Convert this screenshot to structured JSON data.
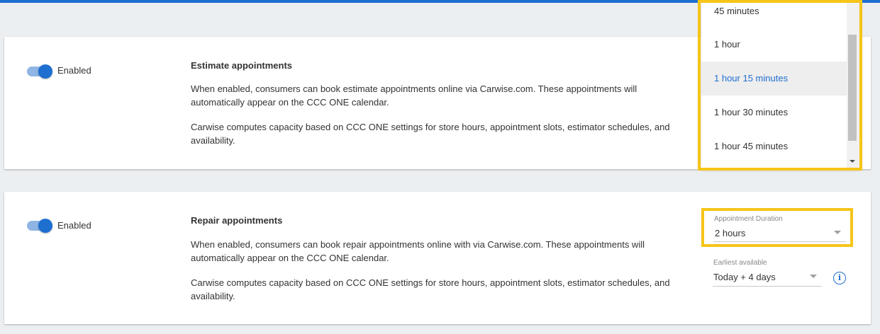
{
  "sections": [
    {
      "toggle_label": "Enabled",
      "title": "Estimate appointments",
      "para1": "When enabled, consumers can book estimate appointments online via Carwise.com. These appointments will automatically appear on the CCC ONE calendar.",
      "para2": "Carwise computes capacity based on CCC ONE settings for store hours, appointment slots, estimator schedules, and availability."
    },
    {
      "toggle_label": "Enabled",
      "title": "Repair appointments",
      "para1": "When enabled, consumers can book repair appointments online with via Carwise.com. These appointments will automatically appear on the CCC ONE calendar.",
      "para2": "Carwise computes capacity based on CCC ONE settings for store hours, appointment slots, estimator schedules, and availability.",
      "duration_label": "Appointment Duration",
      "duration_value": "2 hours",
      "earliest_label": "Earliest available",
      "earliest_value": "Today + 4 days"
    }
  ],
  "dropdown": {
    "options": [
      "45 minutes",
      "1 hour",
      "1 hour 15 minutes",
      "1 hour 30 minutes",
      "1 hour 45 minutes"
    ],
    "selected": "1 hour 15 minutes"
  },
  "icons": {
    "info": "i"
  },
  "colors": {
    "accent": "#1e6fd0",
    "highlight": "#f5c518"
  }
}
